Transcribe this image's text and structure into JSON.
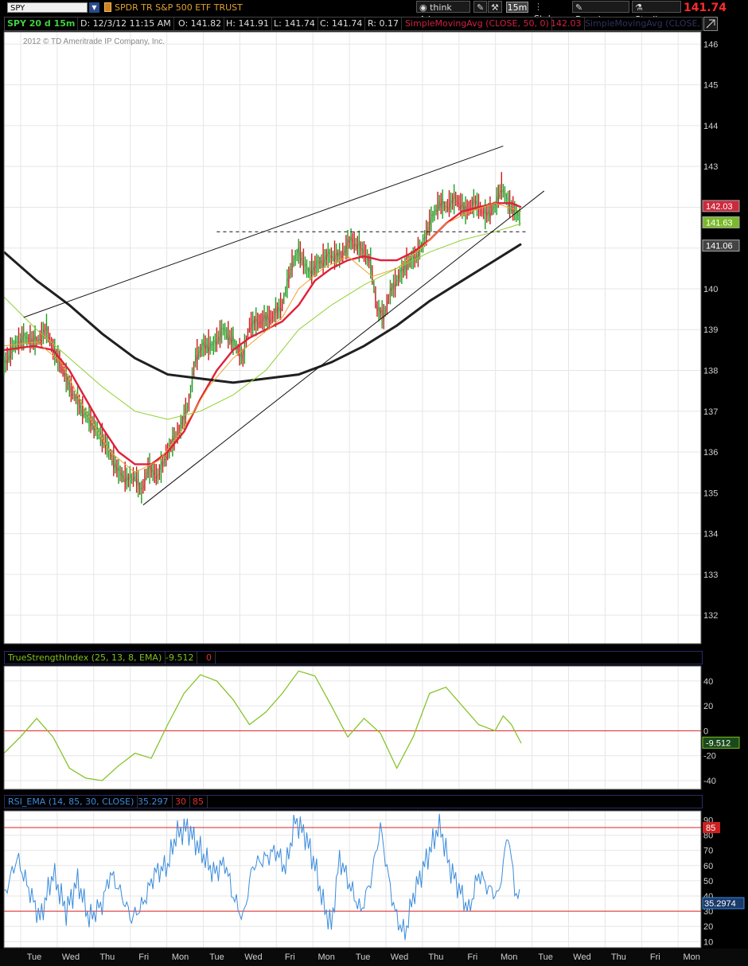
{
  "toolbar": {
    "symbol": "SPY",
    "symbol_name": "SPDR TR S&P 500 ETF TRUST",
    "think_ai": "think A.I.",
    "interval": "15m",
    "style": "Style",
    "drawings": "Drawings",
    "studies": "Studies",
    "last_price": "141.74"
  },
  "info": {
    "period": "SPY 20 d 15m",
    "date": "D: 12/3/12 11:15 AM",
    "open": "O: 141.82",
    "high": "H: 141.91",
    "low": "L: 141.74",
    "close": "C: 141.74",
    "range": "R: 0.17",
    "sma50": "SimpleMovingAvg (CLOSE, 50, 0)",
    "sma50_value": "142.03",
    "sma200": "SimpleMovingAvg (CLOSE,",
    "copyright": "2012 © TD Ameritrade IP Company, Inc."
  },
  "tsi_legend": {
    "label": "TrueStrengthIndex (25, 13, 8, EMA)",
    "value": "-9.512",
    "zero": "0"
  },
  "rsi_legend": {
    "label": "RSI_EMA (14, 85, 30, CLOSE)",
    "value": "35.297",
    "low": "30",
    "high": "85"
  },
  "colors": {
    "sma_red": "#e0203a",
    "sma_orange": "#f0a030",
    "sma_green": "#90d030",
    "sma_black": "#202020",
    "tsi": "#80c020",
    "rsi": "#3a8cdc",
    "grid": "#e6e6e6"
  },
  "chart_data": [
    {
      "type": "candlestick",
      "title": "SPY 20 d 15m",
      "ylim": [
        131.3,
        146.3
      ],
      "y_ticks": [
        "146",
        "145",
        "144",
        "143",
        "142",
        "141",
        "140",
        "139",
        "138",
        "137",
        "136",
        "135",
        "134",
        "133",
        "132"
      ],
      "x_ticks": [
        "Tue",
        "Wed",
        "Thu",
        "Fri",
        "Mon",
        "Tue",
        "Wed",
        "Fri",
        "Mon",
        "Tue",
        "Wed",
        "Thu",
        "Fri",
        "Mon",
        "Tue",
        "Wed",
        "Thu",
        "Fri",
        "Mon"
      ],
      "price_labels": [
        {
          "label": "142.03",
          "color": "#cc2a3c"
        },
        {
          "label": "141.63",
          "color": "#7ab92a"
        },
        {
          "label": "141.06",
          "color": "#444444"
        }
      ],
      "price_path": [
        [
          0,
          138.1
        ],
        [
          6,
          138.6
        ],
        [
          12,
          138.8
        ],
        [
          20,
          138.7
        ],
        [
          26,
          139.0
        ],
        [
          30,
          138.5
        ],
        [
          34,
          138.2
        ],
        [
          40,
          137.6
        ],
        [
          48,
          137.0
        ],
        [
          54,
          136.7
        ],
        [
          62,
          136.2
        ],
        [
          70,
          135.5
        ],
        [
          76,
          135.3
        ],
        [
          80,
          135.4
        ],
        [
          84,
          135.0
        ],
        [
          88,
          135.6
        ],
        [
          94,
          135.4
        ],
        [
          100,
          136.0
        ],
        [
          108,
          136.6
        ],
        [
          113,
          137.2
        ],
        [
          117,
          138.3
        ],
        [
          122,
          138.6
        ],
        [
          128,
          138.6
        ],
        [
          134,
          139.0
        ],
        [
          140,
          138.7
        ],
        [
          146,
          138.3
        ],
        [
          150,
          139.1
        ],
        [
          156,
          139.2
        ],
        [
          164,
          139.3
        ],
        [
          170,
          139.6
        ],
        [
          176,
          140.6
        ],
        [
          180,
          140.9
        ],
        [
          186,
          140.4
        ],
        [
          192,
          140.6
        ],
        [
          198,
          140.8
        ],
        [
          206,
          140.8
        ],
        [
          212,
          141.2
        ],
        [
          220,
          140.9
        ],
        [
          224,
          140.6
        ],
        [
          228,
          139.5
        ],
        [
          232,
          139.3
        ],
        [
          236,
          139.9
        ],
        [
          240,
          140.2
        ],
        [
          246,
          140.6
        ],
        [
          252,
          140.8
        ],
        [
          256,
          141.1
        ],
        [
          260,
          141.6
        ],
        [
          266,
          142.1
        ],
        [
          270,
          142.0
        ],
        [
          276,
          142.2
        ],
        [
          282,
          141.9
        ],
        [
          288,
          142.1
        ],
        [
          294,
          141.8
        ],
        [
          300,
          142.0
        ],
        [
          304,
          142.5
        ],
        [
          308,
          142.1
        ],
        [
          312,
          141.9
        ],
        [
          316,
          141.7
        ]
      ],
      "series": [
        {
          "name": "SimpleMovingAvg (CLOSE, 50, 0)",
          "color": "#e0203a",
          "points": [
            [
              0,
              138.5
            ],
            [
              18,
              138.6
            ],
            [
              30,
              138.5
            ],
            [
              40,
              138.0
            ],
            [
              50,
              137.3
            ],
            [
              60,
              136.6
            ],
            [
              70,
              136.0
            ],
            [
              80,
              135.7
            ],
            [
              90,
              135.7
            ],
            [
              100,
              136.0
            ],
            [
              110,
              136.5
            ],
            [
              120,
              137.3
            ],
            [
              130,
              138.0
            ],
            [
              140,
              138.5
            ],
            [
              150,
              138.8
            ],
            [
              160,
              139.0
            ],
            [
              170,
              139.2
            ],
            [
              180,
              139.6
            ],
            [
              190,
              140.2
            ],
            [
              200,
              140.5
            ],
            [
              210,
              140.7
            ],
            [
              220,
              140.8
            ],
            [
              230,
              140.7
            ],
            [
              240,
              140.7
            ],
            [
              250,
              140.9
            ],
            [
              260,
              141.2
            ],
            [
              270,
              141.6
            ],
            [
              280,
              141.9
            ],
            [
              290,
              142.0
            ],
            [
              300,
              142.1
            ],
            [
              310,
              142.1
            ],
            [
              316,
              142.0
            ]
          ]
        },
        {
          "name": "SimpleMovingAvg (CLOSE,",
          "color": "#202020",
          "points": [
            [
              0,
              140.9
            ],
            [
              20,
              140.2
            ],
            [
              40,
              139.6
            ],
            [
              60,
              138.9
            ],
            [
              80,
              138.3
            ],
            [
              100,
              137.9
            ],
            [
              120,
              137.8
            ],
            [
              140,
              137.7
            ],
            [
              160,
              137.8
            ],
            [
              180,
              137.9
            ],
            [
              200,
              138.2
            ],
            [
              220,
              138.6
            ],
            [
              240,
              139.1
            ],
            [
              260,
              139.7
            ],
            [
              280,
              140.2
            ],
            [
              300,
              140.7
            ],
            [
              316,
              141.1
            ]
          ]
        },
        {
          "color": "#f0a030",
          "points": [
            [
              0,
              138.6
            ],
            [
              20,
              138.7
            ],
            [
              35,
              138.2
            ],
            [
              50,
              137.0
            ],
            [
              65,
              136.0
            ],
            [
              80,
              135.5
            ],
            [
              95,
              135.8
            ],
            [
              110,
              136.6
            ],
            [
              125,
              137.6
            ],
            [
              140,
              138.3
            ],
            [
              155,
              138.8
            ],
            [
              170,
              139.3
            ],
            [
              180,
              140.0
            ],
            [
              195,
              140.5
            ],
            [
              210,
              140.8
            ],
            [
              225,
              140.3
            ],
            [
              240,
              140.5
            ],
            [
              255,
              141.0
            ],
            [
              270,
              141.6
            ],
            [
              285,
              141.9
            ],
            [
              300,
              142.1
            ],
            [
              316,
              141.9
            ]
          ]
        },
        {
          "color": "#90d030",
          "points": [
            [
              0,
              139.8
            ],
            [
              20,
              139.0
            ],
            [
              40,
              138.3
            ],
            [
              60,
              137.6
            ],
            [
              80,
              137.0
            ],
            [
              100,
              136.8
            ],
            [
              120,
              137.0
            ],
            [
              140,
              137.4
            ],
            [
              160,
              138.0
            ],
            [
              170,
              138.5
            ],
            [
              180,
              139.0
            ],
            [
              200,
              139.6
            ],
            [
              220,
              140.1
            ],
            [
              240,
              140.5
            ],
            [
              260,
              140.9
            ],
            [
              280,
              141.2
            ],
            [
              300,
              141.4
            ],
            [
              316,
              141.6
            ]
          ]
        }
      ],
      "trendlines": [
        {
          "from": [
            12,
            139.3
          ],
          "to": [
            305,
            143.5
          ],
          "style": "solid"
        },
        {
          "from": [
            85,
            134.7
          ],
          "to": [
            330,
            142.4
          ],
          "style": "solid"
        },
        {
          "from": [
            130,
            141.4
          ],
          "to": [
            320,
            141.4
          ],
          "style": "dashed"
        }
      ]
    },
    {
      "type": "line",
      "title": "TrueStrengthIndex (25, 13, 8, EMA)",
      "ylim": [
        -47,
        52
      ],
      "y_ticks": [
        "40",
        "20",
        "0",
        "-20",
        "-40"
      ],
      "series": [
        {
          "name": "TrueStrengthIndex",
          "color": "#80c020",
          "points": [
            [
              0,
              -18
            ],
            [
              10,
              -5
            ],
            [
              20,
              10
            ],
            [
              30,
              -5
            ],
            [
              40,
              -30
            ],
            [
              50,
              -38
            ],
            [
              60,
              -40
            ],
            [
              70,
              -28
            ],
            [
              80,
              -18
            ],
            [
              90,
              -22
            ],
            [
              100,
              5
            ],
            [
              110,
              30
            ],
            [
              120,
              45
            ],
            [
              130,
              40
            ],
            [
              140,
              25
            ],
            [
              150,
              5
            ],
            [
              160,
              15
            ],
            [
              170,
              30
            ],
            [
              180,
              48
            ],
            [
              190,
              44
            ],
            [
              200,
              20
            ],
            [
              210,
              -5
            ],
            [
              220,
              10
            ],
            [
              230,
              -2
            ],
            [
              240,
              -30
            ],
            [
              250,
              -5
            ],
            [
              260,
              30
            ],
            [
              270,
              35
            ],
            [
              280,
              20
            ],
            [
              290,
              5
            ],
            [
              300,
              0
            ],
            [
              305,
              12
            ],
            [
              310,
              5
            ],
            [
              316,
              -10
            ]
          ]
        }
      ]
    },
    {
      "type": "line",
      "title": "RSI_EMA (14, 85, 30, CLOSE)",
      "ylim": [
        6,
        96
      ],
      "y_ticks": [
        "90",
        "80",
        "70",
        "60",
        "50",
        "40",
        "30",
        "20",
        "10"
      ],
      "series": [
        {
          "name": "RSI_EMA",
          "color": "#3a8cdc",
          "points": [
            [
              0,
              40
            ],
            [
              8,
              65
            ],
            [
              15,
              45
            ],
            [
              22,
              25
            ],
            [
              30,
              55
            ],
            [
              38,
              30
            ],
            [
              45,
              50
            ],
            [
              52,
              25
            ],
            [
              60,
              35
            ],
            [
              65,
              55
            ],
            [
              70,
              45
            ],
            [
              78,
              25
            ],
            [
              85,
              35
            ],
            [
              92,
              55
            ],
            [
              100,
              60
            ],
            [
              105,
              80
            ],
            [
              112,
              85
            ],
            [
              120,
              70
            ],
            [
              128,
              55
            ],
            [
              135,
              62
            ],
            [
              140,
              40
            ],
            [
              146,
              25
            ],
            [
              152,
              60
            ],
            [
              160,
              65
            ],
            [
              166,
              70
            ],
            [
              172,
              58
            ],
            [
              178,
              90
            ],
            [
              184,
              80
            ],
            [
              190,
              60
            ],
            [
              195,
              35
            ],
            [
              200,
              20
            ],
            [
              205,
              65
            ],
            [
              212,
              45
            ],
            [
              218,
              30
            ],
            [
              224,
              50
            ],
            [
              230,
              85
            ],
            [
              236,
              45
            ],
            [
              240,
              25
            ],
            [
              245,
              15
            ],
            [
              250,
              40
            ],
            [
              256,
              58
            ],
            [
              262,
              75
            ],
            [
              266,
              88
            ],
            [
              272,
              60
            ],
            [
              278,
              45
            ],
            [
              284,
              30
            ],
            [
              290,
              55
            ],
            [
              296,
              45
            ],
            [
              302,
              40
            ],
            [
              308,
              82
            ],
            [
              312,
              45
            ],
            [
              316,
              35
            ]
          ]
        }
      ]
    }
  ]
}
